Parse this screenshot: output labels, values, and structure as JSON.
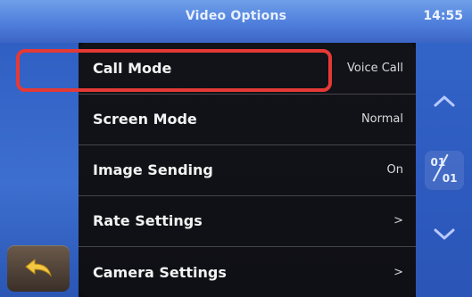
{
  "header": {
    "title": "Video Options",
    "time": "14:55"
  },
  "menu": {
    "items": [
      {
        "label": "Call Mode",
        "value": "Voice Call",
        "kind": "value"
      },
      {
        "label": "Screen Mode",
        "value": "Normal",
        "kind": "value"
      },
      {
        "label": "Image Sending",
        "value": "On",
        "kind": "value"
      },
      {
        "label": "Rate Settings",
        "value": ">",
        "kind": "submenu"
      },
      {
        "label": "Camera Settings",
        "value": ">",
        "kind": "submenu"
      }
    ]
  },
  "pager": {
    "current": "01",
    "total": "01"
  },
  "icons": {
    "back": "back-arrow-icon",
    "scroll_up": "chevron-up-icon",
    "scroll_down": "chevron-down-icon"
  },
  "colors": {
    "accent": "#3c65c5",
    "highlight": "#e53935"
  }
}
